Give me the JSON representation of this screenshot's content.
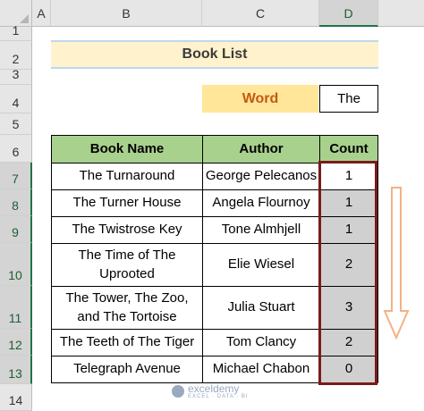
{
  "columns": [
    "A",
    "B",
    "C",
    "D"
  ],
  "rows": [
    "1",
    "2",
    "3",
    "4",
    "5",
    "6",
    "7",
    "8",
    "9",
    "10",
    "11",
    "12",
    "13",
    "14"
  ],
  "title": "Book List",
  "word_label": "Word",
  "word_value": "The",
  "table_headers": {
    "book": "Book Name",
    "author": "Author",
    "count": "Count"
  },
  "books": [
    {
      "name": "The Turnaround",
      "author": "George Pelecanos",
      "count": "1"
    },
    {
      "name": "The Turner House",
      "author": "Angela Flournoy",
      "count": "1"
    },
    {
      "name": "The Twistrose Key",
      "author": "Tone Almhjell",
      "count": "1"
    },
    {
      "name": "The Time of The Uprooted",
      "author": "Elie Wiesel",
      "count": "2"
    },
    {
      "name": "The Tower, The Zoo, and The Tortoise",
      "author": "Julia Stuart",
      "count": "3"
    },
    {
      "name": "The Teeth of The Tiger",
      "author": "Tom Clancy",
      "count": "2"
    },
    {
      "name": "Telegraph Avenue",
      "author": "Michael Chabon",
      "count": "0"
    }
  ],
  "watermark": {
    "name": "exceldemy",
    "tagline": "EXCEL · DATA · BI"
  },
  "colors": {
    "header_green": "#a9d18e",
    "title_fill": "#fff2cc",
    "word_fill": "#ffe699",
    "word_text": "#c55a11",
    "highlight_border": "#7b1a1a",
    "arrow": "#f4b183"
  }
}
